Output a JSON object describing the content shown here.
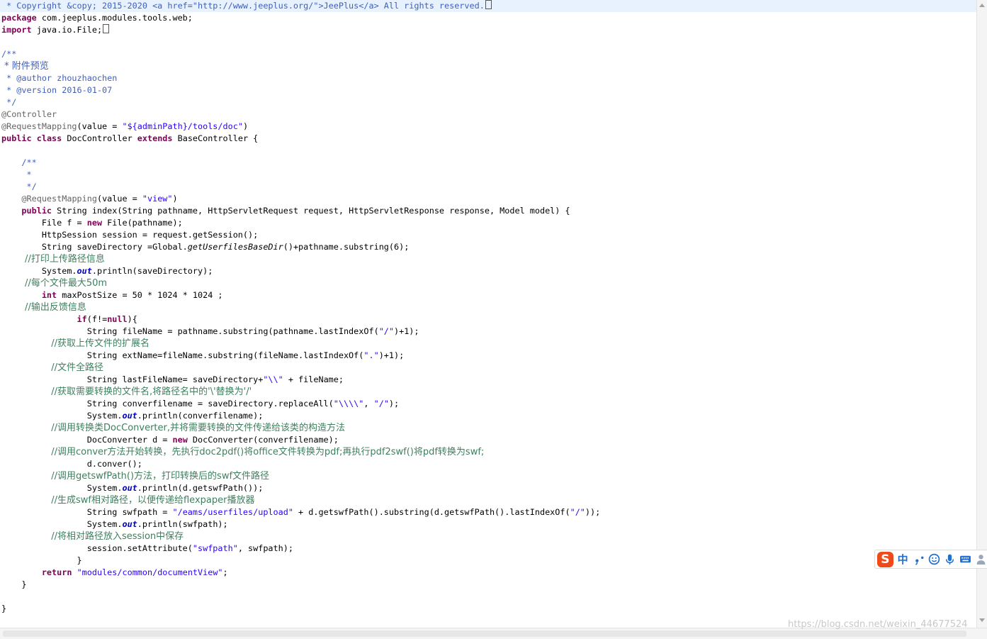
{
  "editor": {
    "lines": [
      " * Copyright &copy; 2015-2020 <a href=\"http://www.jeeplus.org/\">JeePlus</a> All rights reserved.",
      "package com.jeeplus.modules.tools.web;",
      "import java.io.File;",
      "",
      "/**",
      " * 附件预览",
      " * @author zhouzhaochen",
      " * @version 2016-01-07",
      " */",
      "@Controller",
      "@RequestMapping(value = \"${adminPath}/tools/doc\")",
      "public class DocController extends BaseController {",
      "",
      "    /**",
      "     *",
      "     */",
      "    @RequestMapping(value = \"view\")",
      "    public String index(String pathname, HttpServletRequest request, HttpServletResponse response, Model model) {",
      "        File f = new File(pathname);",
      "        HttpSession session = request.getSession();",
      "        String saveDirectory =Global.getUserfilesBaseDir()+pathname.substring(6);",
      "        //打印上传路径信息",
      "        System.out.println(saveDirectory);",
      "        //每个文件最大50m",
      "        int maxPostSize = 50 * 1024 * 1024 ;",
      "        //输出反馈信息",
      "               if(f!=null){",
      "                 String fileName = pathname.substring(pathname.lastIndexOf(\"/\")+1);",
      "                 //获取上传文件的扩展名",
      "                 String extName=fileName.substring(fileName.lastIndexOf(\".\")+1);",
      "                 //文件全路径",
      "                 String lastFileName= saveDirectory+\"\\\\\" + fileName;",
      "                 //获取需要转换的文件名,将路径名中的'\\'替换为'/'",
      "                 String converfilename = saveDirectory.replaceAll(\"\\\\\\\\\", \"/\");",
      "                 System.out.println(converfilename);",
      "                 //调用转换类DocConverter,并将需要转换的文件传递给该类的构造方法",
      "                 DocConverter d = new DocConverter(converfilename);",
      "                 //调用conver方法开始转换，先执行doc2pdf()将office文件转换为pdf;再执行pdf2swf()将pdf转换为swf;",
      "                 d.conver();",
      "                 //调用getswfPath()方法，打印转换后的swf文件路径",
      "                 System.out.println(d.getswfPath());",
      "                 //生成swf相对路径，以便传递给flexpaper播放器",
      "                 String swfpath = \"/eams/userfiles/upload\" + d.getswfPath().substring(d.getswfPath().lastIndexOf(\"/\"));",
      "                 System.out.println(swfpath);",
      "                 //将相对路径放入session中保存",
      "                 session.setAttribute(\"swfpath\", swfpath);",
      "               }",
      "        return \"modules/common/documentView\";",
      "    }",
      "",
      "}"
    ]
  },
  "ime": {
    "logo": "S",
    "mode": "中",
    "icons": [
      "punctuation-icon",
      "emoji-icon",
      "microphone-icon",
      "keyboard-icon",
      "user-icon"
    ]
  },
  "watermark": "https://blog.csdn.net/weixin_44677524"
}
